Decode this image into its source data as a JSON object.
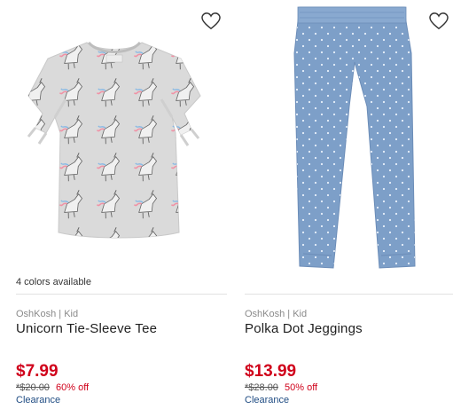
{
  "products": [
    {
      "image_alt": "Gray unicorn print tee with tie sleeves",
      "colors_available": "4 colors available",
      "brand": "OshKosh | Kid",
      "title": "Unicorn Tie-Sleeve Tee",
      "price": "$7.99",
      "original_price": "*$20.00",
      "discount": "60% off",
      "status": "Clearance",
      "icon": "heart-outline-icon"
    },
    {
      "image_alt": "Light blue polka dot jeggings",
      "brand": "OshKosh | Kid",
      "title": "Polka Dot Jeggings",
      "price": "$13.99",
      "original_price": "*$28.00",
      "discount": "50% off",
      "status": "Clearance",
      "icon": "heart-outline-icon"
    }
  ],
  "colors": {
    "sale_red": "#d0021b",
    "clearance_blue": "#1e4b82",
    "brand_gray": "#8a8a8a",
    "tee_gray": "#d9d9d9",
    "denim_blue": "#7d9fc8"
  }
}
